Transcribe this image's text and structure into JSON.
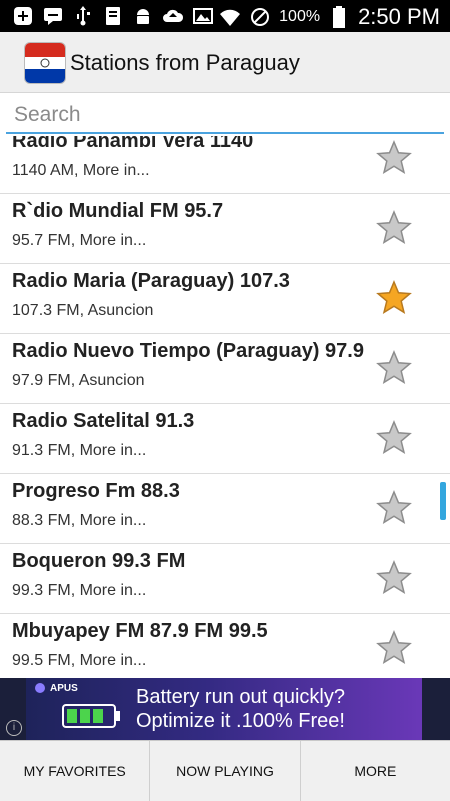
{
  "status_bar": {
    "battery_percent": "100%",
    "time": "2:50 PM",
    "icons": [
      "add-icon",
      "chat-icon",
      "usb-icon",
      "download-icon",
      "android-icon",
      "cloud-upload-icon",
      "image-icon",
      "wifi-icon",
      "do-not-disturb-icon",
      "battery-icon"
    ]
  },
  "header": {
    "title": "Stations from Paraguay",
    "flag_colors": {
      "top": "#d52b1e",
      "middle": "#ffffff",
      "bottom": "#0038a8"
    }
  },
  "search": {
    "placeholder": "Search",
    "value": ""
  },
  "stations": [
    {
      "name": "Radio Panambi Vera 1140",
      "detail": "1140 AM, More in...",
      "favorite": false
    },
    {
      "name": "R`dio Mundial FM 95.7",
      "detail": "95.7 FM, More in...",
      "favorite": false
    },
    {
      "name": "Radio Maria (Paraguay) 107.3",
      "detail": "107.3 FM, Asuncion",
      "favorite": true
    },
    {
      "name": "Radio Nuevo Tiempo (Paraguay) 97.9",
      "detail": "97.9 FM, Asuncion",
      "favorite": false
    },
    {
      "name": "Radio Satelital 91.3",
      "detail": "91.3 FM, More in...",
      "favorite": false
    },
    {
      "name": "Progreso Fm 88.3",
      "detail": "88.3 FM, More in...",
      "favorite": false
    },
    {
      "name": "Boqueron 99.3 FM",
      "detail": "99.3 FM, More in...",
      "favorite": false
    },
    {
      "name": "Mbuyapey FM 87.9 FM 99.5",
      "detail": "99.5 FM, More in...",
      "favorite": false
    }
  ],
  "colors": {
    "accent": "#33a6de",
    "star_active": "#f5a623",
    "star_inactive": "#c8c8c8"
  },
  "ad": {
    "brand": "APUS",
    "line1": "Battery run out quickly?",
    "line2": "Optimize it .100% Free!",
    "info": "i"
  },
  "bottom_nav": {
    "favorites": "MY FAVORITES",
    "now_playing": "NOW PLAYING",
    "more": "MORE"
  }
}
